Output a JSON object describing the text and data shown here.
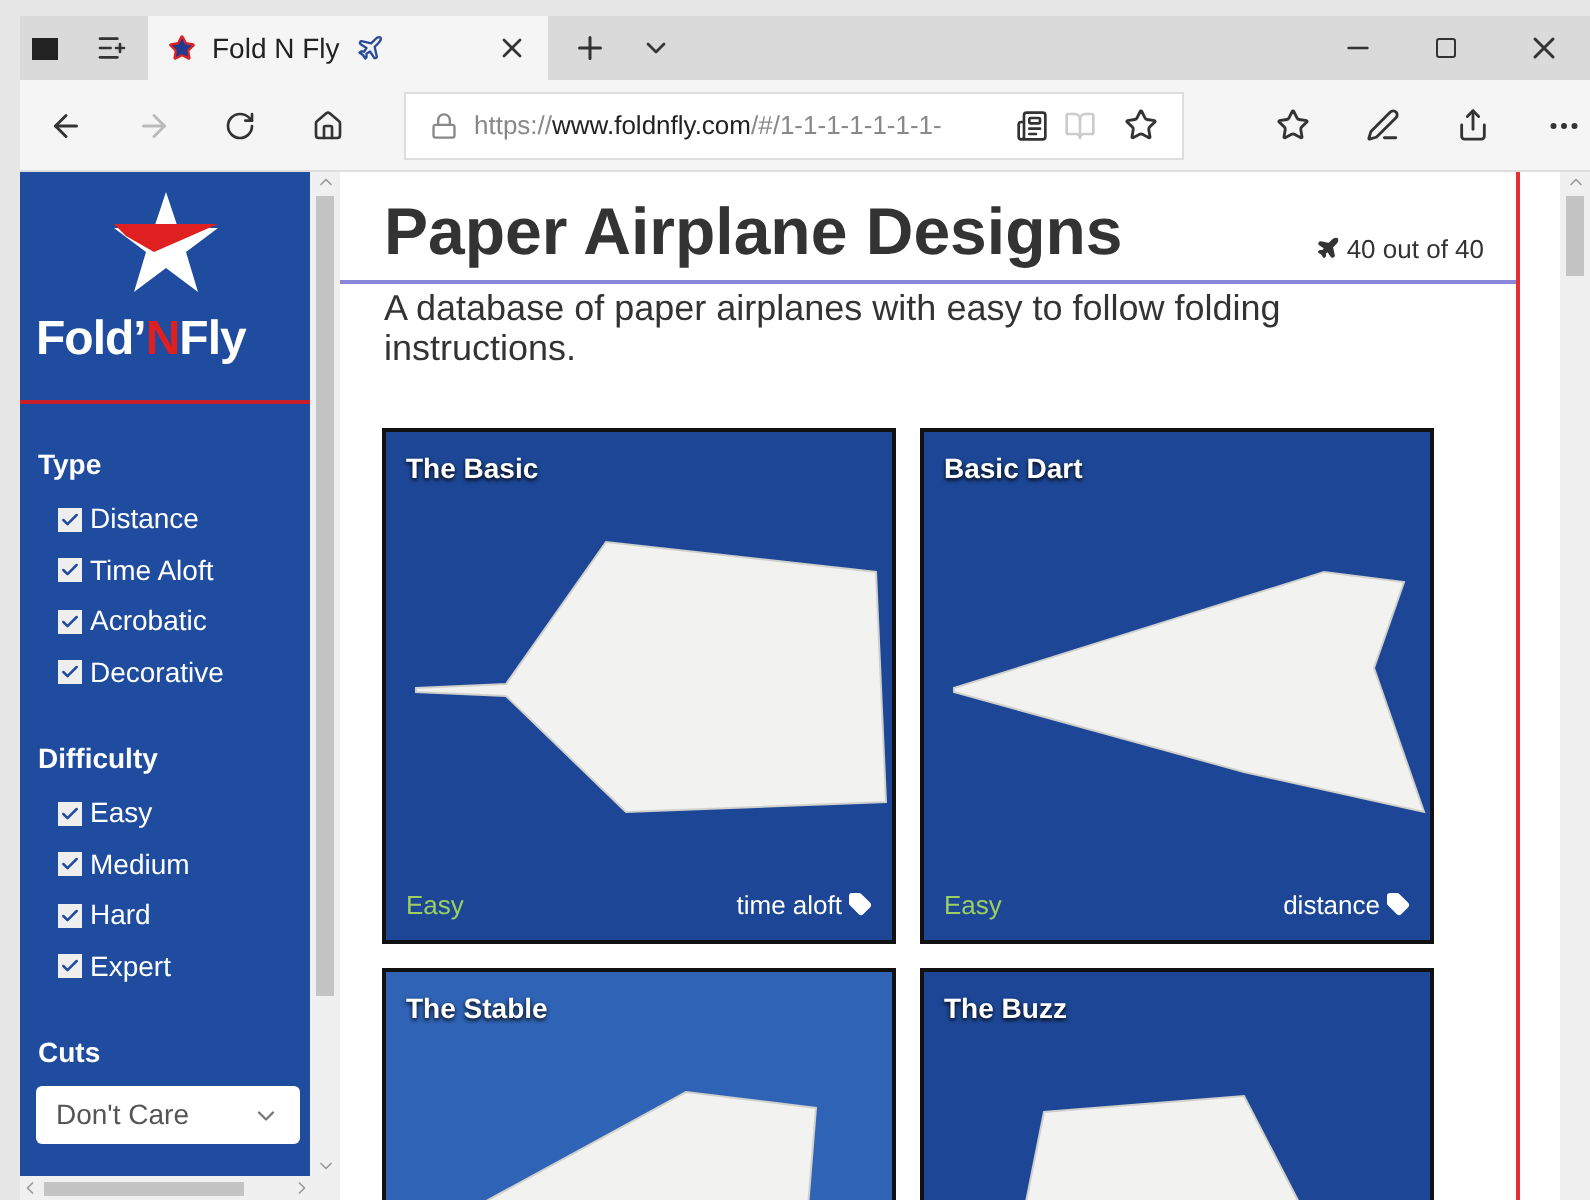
{
  "browser": {
    "tab": {
      "title": "Fold N Fly",
      "selected": true
    },
    "address": {
      "scheme": "https://",
      "host": "www.foldnfly.com",
      "path": "/#/1-1-1-1-1-1-1-"
    },
    "forward_disabled": true
  },
  "sidebar": {
    "logo": {
      "before": "Fold’",
      "highlight": "N",
      "after": "Fly"
    },
    "filters": [
      {
        "heading": "Type",
        "options": [
          {
            "label": "Distance",
            "checked": true
          },
          {
            "label": "Time Aloft",
            "checked": true
          },
          {
            "label": "Acrobatic",
            "checked": true
          },
          {
            "label": "Decorative",
            "checked": true
          }
        ]
      },
      {
        "heading": "Difficulty",
        "options": [
          {
            "label": "Easy",
            "checked": true
          },
          {
            "label": "Medium",
            "checked": true
          },
          {
            "label": "Hard",
            "checked": true
          },
          {
            "label": "Expert",
            "checked": true
          }
        ]
      }
    ],
    "cuts": {
      "heading": "Cuts",
      "value": "Don't Care"
    }
  },
  "main": {
    "title": "Paper Airplane Designs",
    "count": "40 out of 40",
    "subtitle": "A database of paper airplanes with easy to follow folding instructions.",
    "cards": [
      {
        "title": "The Basic",
        "difficulty": "Easy",
        "tag": "time aloft"
      },
      {
        "title": "Basic Dart",
        "difficulty": "Easy",
        "tag": "distance"
      },
      {
        "title": "The Stable"
      },
      {
        "title": "The Buzz"
      }
    ]
  }
}
